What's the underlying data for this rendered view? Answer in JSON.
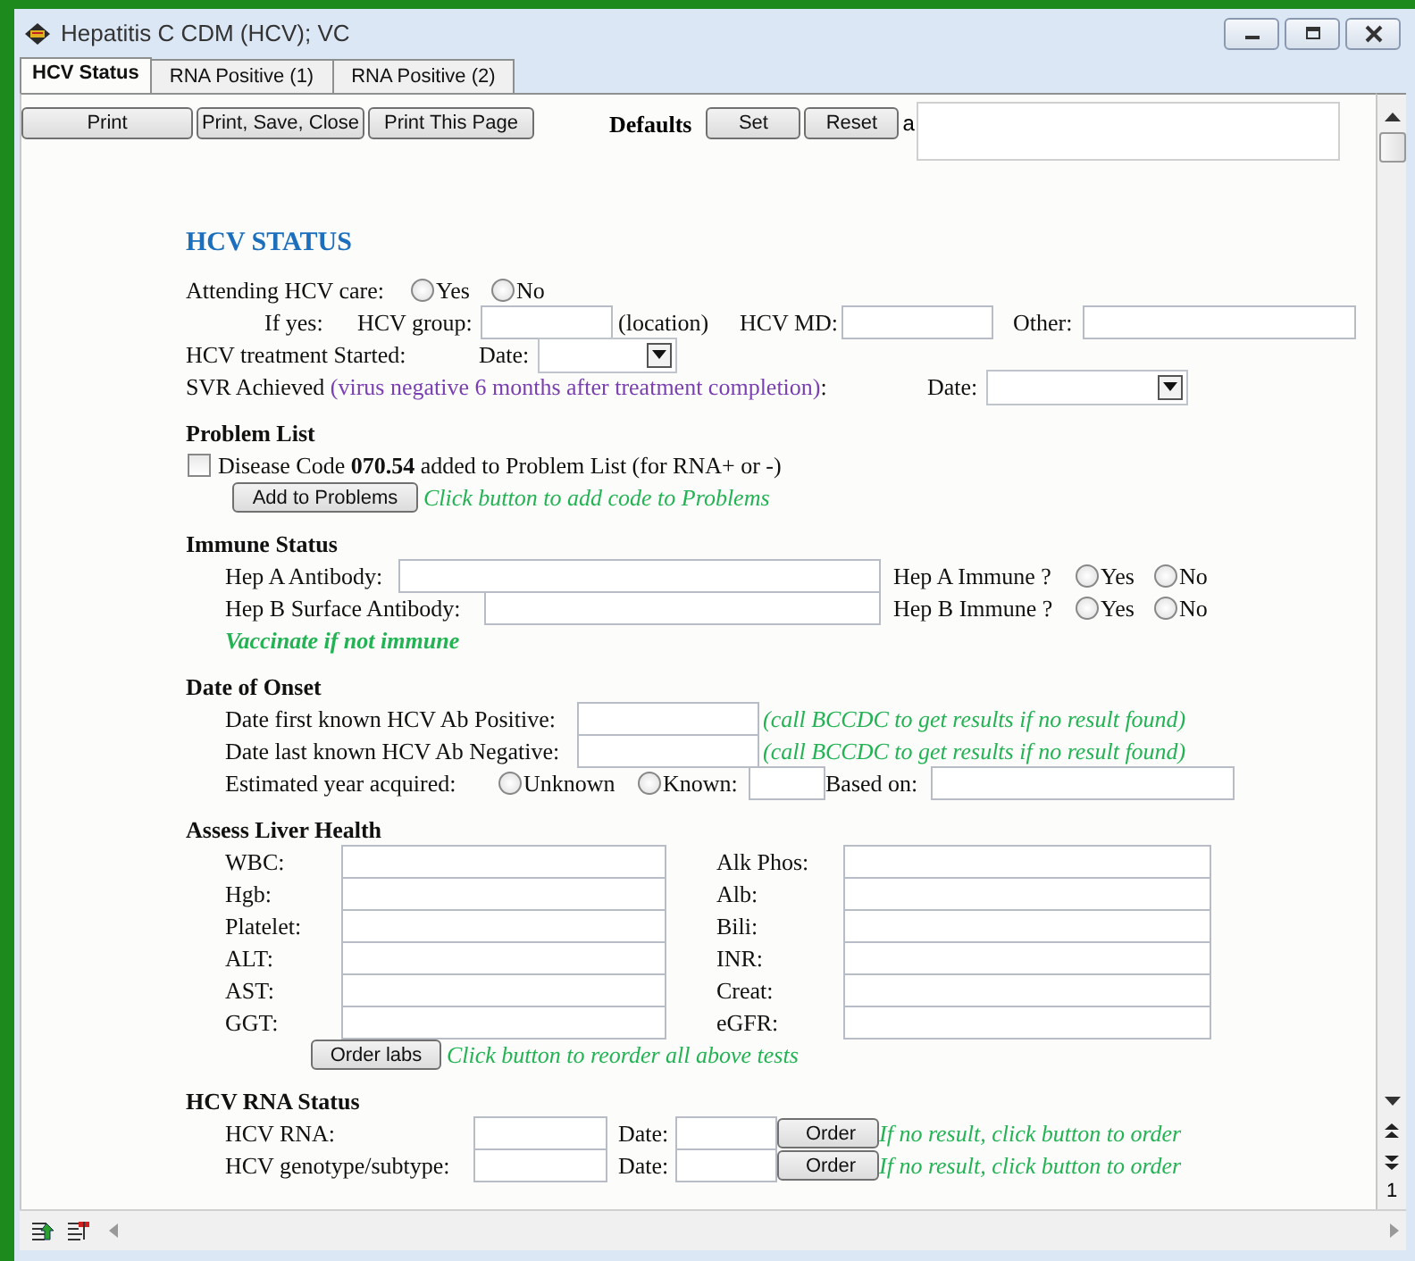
{
  "window": {
    "title": "Hepatitis C CDM (HCV); VC"
  },
  "tabs": [
    {
      "label": "HCV Status",
      "selected": true
    },
    {
      "label": "RNA Positive (1)",
      "selected": false
    },
    {
      "label": "RNA Positive (2)",
      "selected": false
    }
  ],
  "toolbar": {
    "buttons": [
      "Print",
      "Print, Save, Close",
      "Print This Page"
    ],
    "defaults_label": "Defaults",
    "default_buttons": [
      "Set",
      "Reset"
    ],
    "note_label": "a"
  },
  "form": {
    "sections": [
      {
        "kind": "heading",
        "title": "HCV STATUS",
        "rows": [
          {
            "items": [
              {
                "kind": "label",
                "text": "Attending HCV care:"
              },
              {
                "kind": "radio",
                "text": "Yes",
                "selected": false
              },
              {
                "kind": "radio",
                "text": "No",
                "selected": false
              }
            ]
          },
          {
            "items": [
              {
                "kind": "label",
                "text": "If yes:"
              },
              {
                "kind": "label",
                "text": "HCV group:"
              },
              {
                "kind": "field"
              },
              {
                "kind": "label",
                "text": "(location)"
              },
              {
                "kind": "label",
                "text": "HCV MD:"
              },
              {
                "kind": "field"
              },
              {
                "kind": "label",
                "text": "Other:"
              },
              {
                "kind": "field"
              }
            ]
          },
          {
            "items": [
              {
                "kind": "label",
                "text": "HCV treatment Started:"
              },
              {
                "kind": "label",
                "text": "Date:"
              },
              {
                "kind": "select"
              }
            ]
          },
          {
            "items": [
              {
                "kind": "label",
                "text": "SVR Achieved",
                "aside": "(virus negative 6 months after treatment completion)",
                "after": ":"
              },
              {
                "kind": "label",
                "text": "Date:"
              },
              {
                "kind": "select"
              }
            ]
          }
        ]
      },
      {
        "kind": "section",
        "title": "Problem List",
        "rows": [
          {
            "items": [
              {
                "kind": "checkbox",
                "text": "Disease Code **070.54** added to Problem List (for RNA+ or -)",
                "checked": false
              }
            ]
          },
          {
            "items": [
              {
                "kind": "button",
                "text": "Add to Problems"
              },
              {
                "kind": "hint",
                "text": "Click button to add code to Problems"
              }
            ]
          }
        ]
      },
      {
        "kind": "section",
        "title": "Immune Status",
        "rows": [
          {
            "items": [
              {
                "kind": "label",
                "text": "Hep A Antibody:"
              },
              {
                "kind": "field"
              },
              {
                "kind": "label",
                "text": "Hep A Immune ?"
              },
              {
                "kind": "radio",
                "text": "Yes",
                "selected": false
              },
              {
                "kind": "radio",
                "text": "No",
                "selected": false
              }
            ]
          },
          {
            "items": [
              {
                "kind": "label",
                "text": "Hep B Surface Antibody:"
              },
              {
                "kind": "field"
              },
              {
                "kind": "label",
                "text": "Hep B Immune ?"
              },
              {
                "kind": "radio",
                "text": "Yes",
                "selected": false
              },
              {
                "kind": "radio",
                "text": "No",
                "selected": false
              }
            ]
          },
          {
            "items": [
              {
                "kind": "alert",
                "text": "Vaccinate if not immune"
              }
            ]
          }
        ]
      },
      {
        "kind": "section",
        "title": "Date of Onset",
        "rows": [
          {
            "items": [
              {
                "kind": "label",
                "text": "Date first known HCV Ab Positive:"
              },
              {
                "kind": "field"
              },
              {
                "kind": "hint",
                "text": "(call BCCDC to get results if no result found)"
              }
            ]
          },
          {
            "items": [
              {
                "kind": "label",
                "text": "Date last known HCV Ab Negative:"
              },
              {
                "kind": "field"
              },
              {
                "kind": "hint",
                "text": "(call BCCDC to get results if no result found)"
              }
            ]
          },
          {
            "items": [
              {
                "kind": "label",
                "text": "Estimated year acquired:"
              },
              {
                "kind": "radio",
                "text": "Unknown",
                "selected": false
              },
              {
                "kind": "radio",
                "text": "Known:",
                "selected": false
              },
              {
                "kind": "field"
              },
              {
                "kind": "label",
                "text": "Based on:"
              },
              {
                "kind": "field"
              }
            ]
          }
        ]
      },
      {
        "kind": "section",
        "title": "Assess Liver Health",
        "rows": [
          {
            "items": [
              {
                "kind": "label",
                "text": "WBC:"
              },
              {
                "kind": "field"
              },
              {
                "kind": "label",
                "text": "Alk Phos:"
              },
              {
                "kind": "field"
              }
            ]
          },
          {
            "items": [
              {
                "kind": "label",
                "text": "Hgb:"
              },
              {
                "kind": "field"
              },
              {
                "kind": "label",
                "text": "Alb:"
              },
              {
                "kind": "field"
              }
            ]
          },
          {
            "items": [
              {
                "kind": "label",
                "text": "Platelet:"
              },
              {
                "kind": "field"
              },
              {
                "kind": "label",
                "text": "Bili:"
              },
              {
                "kind": "field"
              }
            ]
          },
          {
            "items": [
              {
                "kind": "label",
                "text": "ALT:"
              },
              {
                "kind": "field"
              },
              {
                "kind": "label",
                "text": "INR:"
              },
              {
                "kind": "field"
              }
            ]
          },
          {
            "items": [
              {
                "kind": "label",
                "text": "AST:"
              },
              {
                "kind": "field"
              },
              {
                "kind": "label",
                "text": "Creat:"
              },
              {
                "kind": "field"
              }
            ]
          },
          {
            "items": [
              {
                "kind": "label",
                "text": "GGT:"
              },
              {
                "kind": "field"
              },
              {
                "kind": "label",
                "text": "eGFR:"
              },
              {
                "kind": "field"
              }
            ]
          },
          {
            "items": [
              {
                "kind": "button",
                "text": "Order labs"
              },
              {
                "kind": "hint",
                "text": "Click button to reorder all above tests"
              }
            ]
          }
        ]
      },
      {
        "kind": "section",
        "title": "HCV RNA Status",
        "rows": [
          {
            "items": [
              {
                "kind": "label",
                "text": "HCV RNA:"
              },
              {
                "kind": "field"
              },
              {
                "kind": "label",
                "text": "Date:"
              },
              {
                "kind": "field"
              },
              {
                "kind": "button",
                "text": "Order"
              },
              {
                "kind": "hint",
                "text": "If no result, click button to order"
              }
            ]
          },
          {
            "items": [
              {
                "kind": "label",
                "text": "HCV genotype/subtype:"
              },
              {
                "kind": "field"
              },
              {
                "kind": "label",
                "text": "Date:"
              },
              {
                "kind": "field"
              },
              {
                "kind": "button",
                "text": "Order"
              },
              {
                "kind": "hint",
                "text": "If no result, click button to order"
              }
            ]
          }
        ]
      }
    ]
  },
  "scrollbar": {
    "page": "1"
  }
}
